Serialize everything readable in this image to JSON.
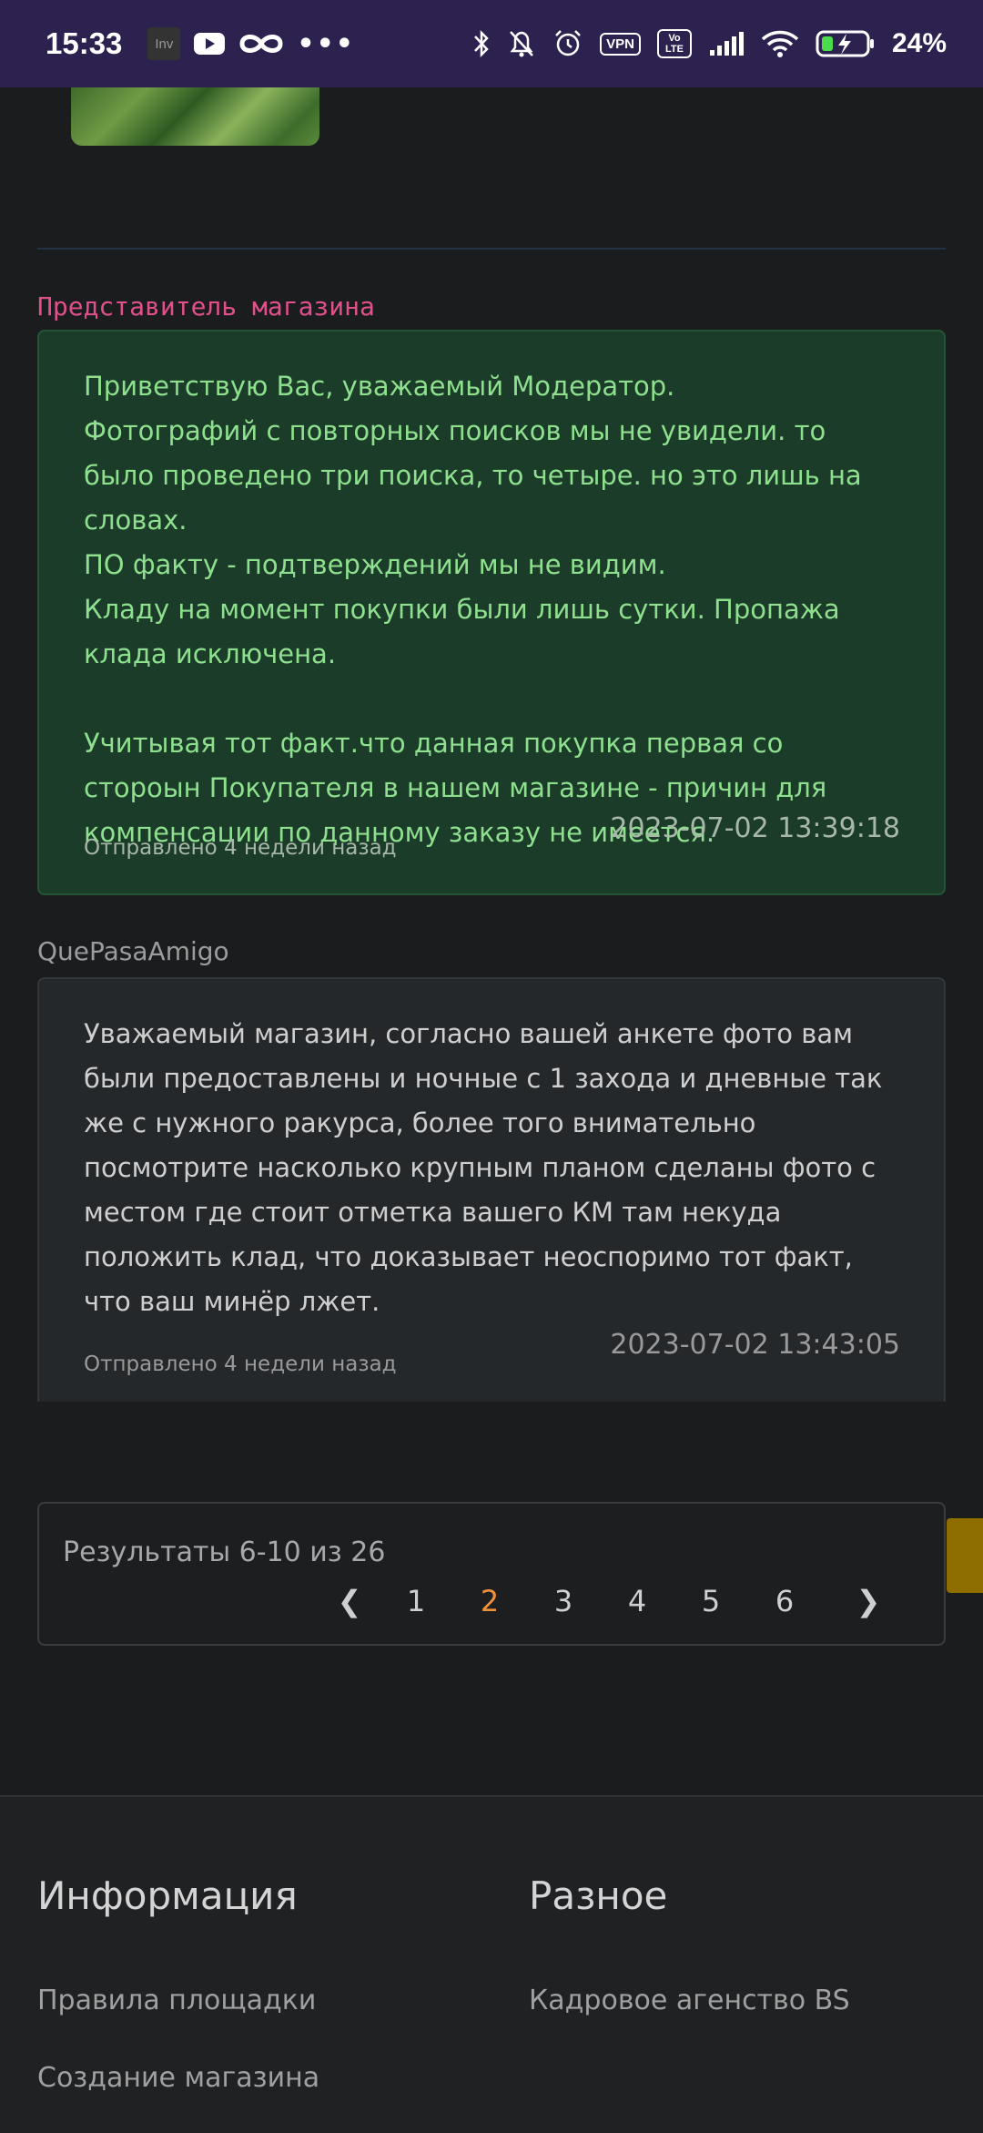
{
  "status_bar": {
    "time": "15:33",
    "inv_icon": "Inv",
    "vpn": "VPN",
    "volte": "Vo LTE",
    "battery": "24%"
  },
  "messages": [
    {
      "author": "Представитель магазина",
      "text": "Приветствую Вас, уважаемый Модератор.\nФотографий с повторных поисков мы не увидели. то было проведено три поиска, то четыре. но это лишь на словах.\nПО факту - подтверждений мы не видим.\nКладу на момент покупки были лишь сутки. Пропажа клада исключена.\n\nУчитывая тот факт.что данная покупка первая со стороын Покупателя в нашем магазине - причин для компенсации по данному заказу не имеется.",
      "date": "2023-07-02 13:39:18",
      "sent": "Отправлено 4 недели назад"
    },
    {
      "author": "QuePasaAmigo",
      "text": "Уважаемый магазин, согласно вашей анкете фото вам были предоставлены и ночные с 1 захода и дневные так же с нужного ракурса, более того внимательно посмотрите насколько крупным планом сделаны фото с местом где стоит отметка вашего КМ там некуда положить клад, что доказывает неоспоримо тот факт, что ваш минёр лжет.",
      "date": "2023-07-02 13:43:05",
      "sent": "Отправлено 4 недели назад"
    }
  ],
  "pagination": {
    "results": "Результаты 6-10 из 26",
    "prev": "❮",
    "next": "❯",
    "pages": [
      "1",
      "2",
      "3",
      "4",
      "5",
      "6"
    ],
    "active_page": "2"
  },
  "footer": {
    "col1_title": "Информация",
    "col1_links": [
      "Правила площадки",
      "Создание магазина"
    ],
    "col2_title": "Разное",
    "col2_links": [
      "Кадровое агенство BS"
    ]
  }
}
